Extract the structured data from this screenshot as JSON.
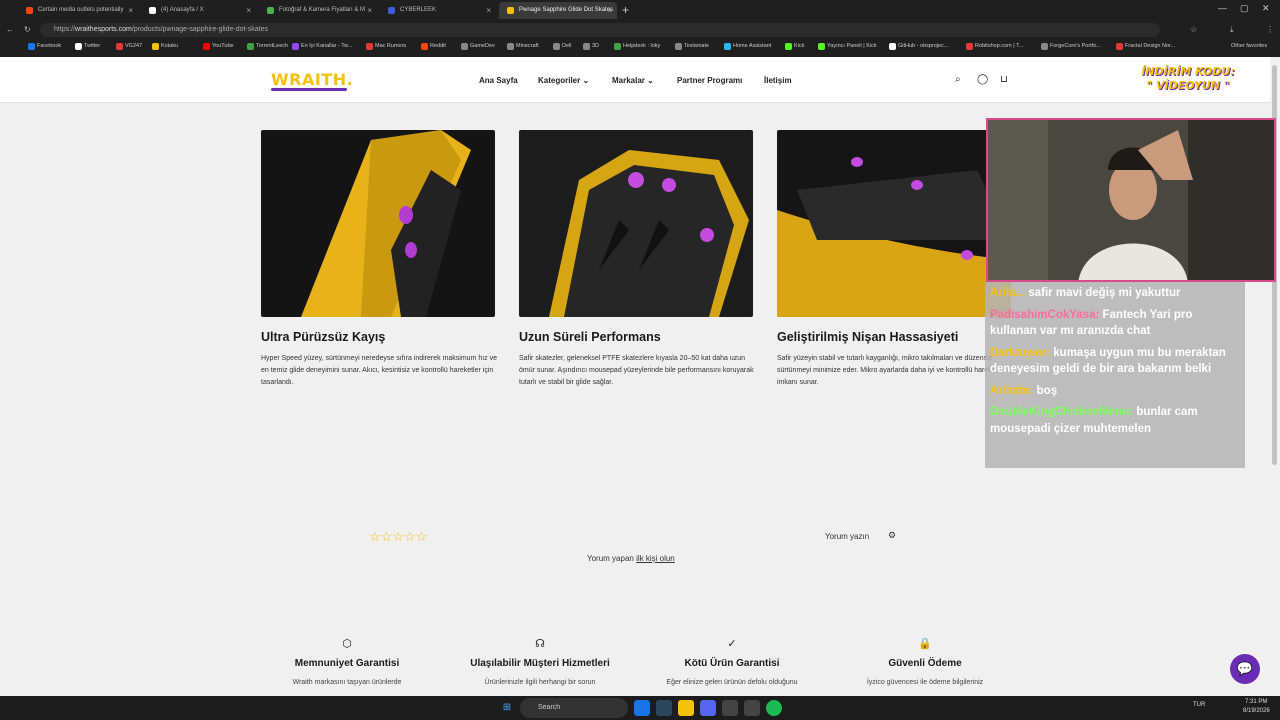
{
  "browser": {
    "tabs": [
      {
        "label": "Certain media outlets potentially",
        "fav": "#ff4500"
      },
      {
        "label": "(4) Anasayfa / X",
        "fav": "#ffffff"
      },
      {
        "label": "Fotoğraf & Kamera Fiyatları & M",
        "fav": "#4caf50"
      },
      {
        "label": "CYBERLEEK",
        "fav": "#3b5bdb"
      },
      {
        "label": "Pwnage Sapphire Glide Dot Skates",
        "fav": "#f4c20d"
      }
    ],
    "url_prefix": "https://",
    "url_domain": "wraithesports.com",
    "url_path": "/products/pwnage-sapphire-glide-dot-skates",
    "bookmarks": [
      {
        "label": "Facebook",
        "c": "#1877f2"
      },
      {
        "label": "Twitter",
        "c": "#ffffff"
      },
      {
        "label": "VG247",
        "c": "#e53935"
      },
      {
        "label": "Kotaku",
        "c": "#f4c20d"
      },
      {
        "label": "YouTube",
        "c": "#ff0000"
      },
      {
        "label": "TorrentLeech",
        "c": "#43a047"
      },
      {
        "label": "En İyi Kanallar - Tw...",
        "c": "#9146ff"
      },
      {
        "label": "Mac Rumors",
        "c": "#e53935"
      },
      {
        "label": "Reddit",
        "c": "#ff4500"
      },
      {
        "label": "GameDev",
        "c": "#888888"
      },
      {
        "label": "Minecraft",
        "c": "#888888"
      },
      {
        "label": "Dell",
        "c": "#888888"
      },
      {
        "label": "3D",
        "c": "#888888"
      },
      {
        "label": "Helpdesk : loky",
        "c": "#43a047"
      },
      {
        "label": "Teslamate",
        "c": "#888888"
      },
      {
        "label": "Home Assistant",
        "c": "#29b6f6"
      },
      {
        "label": "Kick",
        "c": "#53fc18"
      },
      {
        "label": "Yayıncı Paneli | Kick",
        "c": "#53fc18"
      },
      {
        "label": "GitHub - obsprojec...",
        "c": "#ffffff"
      },
      {
        "label": "Robitshop.com | T...",
        "c": "#e53935"
      },
      {
        "label": "ForgeCore's Portfo...",
        "c": "#888888"
      },
      {
        "label": "Fractal Design Nor...",
        "c": "#e53935"
      }
    ],
    "other_favorites": "Other favorites"
  },
  "site": {
    "logo": "WRAITH.",
    "nav": [
      "Ana Sayfa",
      "Kategoriler",
      "Markalar",
      "Partner Programı",
      "İletişim"
    ],
    "promo_line1": "İNDİRİM KODU:",
    "promo_line2": "\" VİDEOYUN \"",
    "cards": [
      {
        "title": "Ultra Pürüzsüz Kayış",
        "desc": "Hyper Speed yüzey, sürtünmeyi neredeyse sıfıra indirerek maksimum hız ve en temiz glide deneyimini sunar. Akıcı, kesintisiz ve kontrollü hareketler için tasarlandı."
      },
      {
        "title": "Uzun Süreli Performans",
        "desc": "Safir skatezler, geleneksel PTFE skatezlere kıyasla 20–50 kat daha uzun ömür sunar. Aşındırıcı mousepad yüzeylerinde bile performansını koruyarak tutarlı ve stabil bir glide sağlar."
      },
      {
        "title": "Geliştirilmiş Nişan Hassasiyeti",
        "desc": "Safir yüzeyin stabil ve tutarlı kayganlığı, mikro takılmaları ve düzensiz sürtünmeyi minimize eder. Mikro ayarlarda daha iyi ve kontrollü hareket imkanı sunar."
      }
    ],
    "stars": "☆☆☆☆☆",
    "write_review": "Yorum yazın",
    "first_prefix": "Yorum yapan ",
    "first_link": "ilk kişi olun",
    "features": [
      {
        "icon": "box-icon",
        "glyph": "⬡",
        "title": "Memnuniyet Garantisi",
        "desc": "Wraith markasını taşıyan ürünlerde"
      },
      {
        "icon": "headset-icon",
        "glyph": "☊",
        "title": "Ulaşılabilir Müşteri Hizmetleri",
        "desc": "Ürünlerinizle ilgili herhangi bir sorun"
      },
      {
        "icon": "check-circle-icon",
        "glyph": "✓",
        "title": "Kötü Ürün Garantisi",
        "desc": "Eğer elinize gelen ürünün defolu olduğunu"
      },
      {
        "icon": "lock-icon",
        "glyph": "🔒",
        "title": "Güvenli Ödeme",
        "desc": "İyzico güvencesi ile ödeme bilgileriniz"
      }
    ]
  },
  "chat": [
    {
      "user": "Arila...",
      "color": "#f4c20d",
      "msg": "safir mavi değiş mi yakuttur"
    },
    {
      "user": "PadisahimCokYasa:",
      "color": "#ff6b9a",
      "msg": "Fantech Yari pro kullanan var mı aranızda chat"
    },
    {
      "user": "Darktower:",
      "color": "#f4c20d",
      "msg": "kumaşa uygun mu bu meraktan deneyesim geldi de bir ara bakarım belki"
    },
    {
      "user": "Arilette:",
      "color": "#f4c20d",
      "msg": "boş"
    },
    {
      "user": "DoubleKingChickenMenu:",
      "color": "#7cff5a",
      "msg": "bunlar cam mousepadi çizer muhtemelen"
    }
  ],
  "taskbar": {
    "search": "Search",
    "lang": "TUR",
    "time": "7:31 PM",
    "date": "8/19/2026"
  }
}
